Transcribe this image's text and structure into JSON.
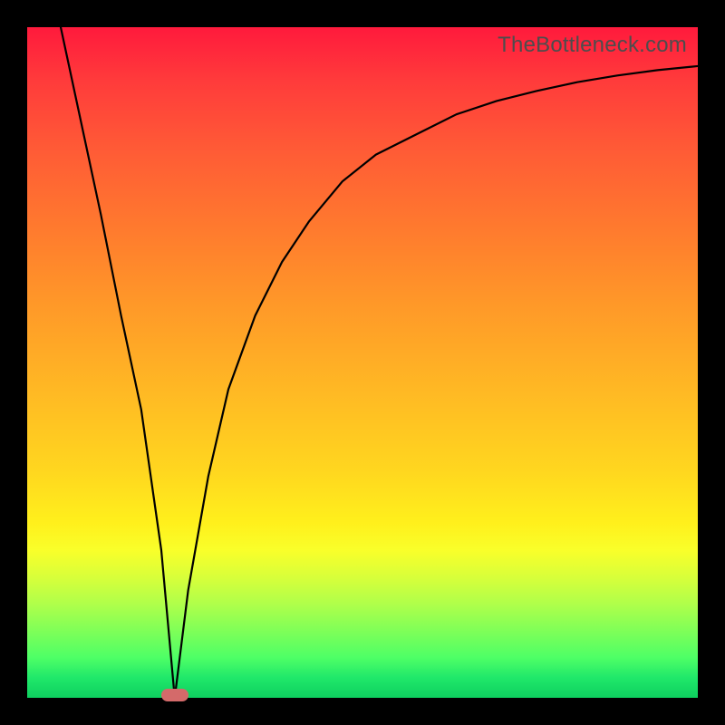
{
  "watermark": "TheBottleneck.com",
  "colors": {
    "frame": "#000000",
    "curve": "#000000",
    "marker": "#d46a6a",
    "gradient_top": "#ff1a3c",
    "gradient_bottom": "#0ecf5f"
  },
  "chart_data": {
    "type": "line",
    "title": "",
    "xlabel": "",
    "ylabel": "",
    "xlim": [
      0,
      100
    ],
    "ylim": [
      0,
      100
    ],
    "grid": false,
    "legend": false,
    "annotations": [
      {
        "type": "marker",
        "x": 22,
        "y": 0,
        "shape": "pill",
        "color": "#d46a6a"
      }
    ],
    "series": [
      {
        "name": "bottleneck-curve",
        "x": [
          5,
          8,
          11,
          14,
          17,
          20,
          22,
          24,
          27,
          30,
          34,
          38,
          42,
          47,
          52,
          58,
          64,
          70,
          76,
          82,
          88,
          94,
          100
        ],
        "y": [
          100,
          86,
          72,
          57,
          43,
          22,
          0,
          16,
          33,
          46,
          57,
          65,
          71,
          77,
          81,
          84,
          87,
          89,
          90.5,
          91.8,
          92.8,
          93.6,
          94.2
        ]
      }
    ]
  }
}
